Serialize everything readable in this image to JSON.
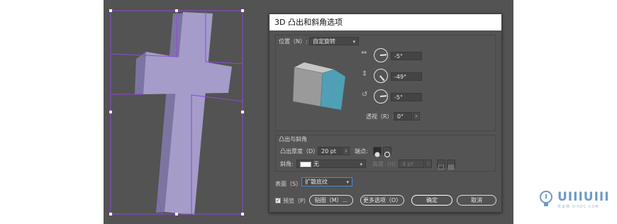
{
  "dialog": {
    "title": "3D 凸出和斜角选项"
  },
  "position": {
    "label": "位置（N）:",
    "preset": "自定旋转",
    "x_angle": "-5°",
    "y_angle": "-49°",
    "z_angle": "-5°",
    "perspective_label": "透视（R）:",
    "perspective_value": "0°"
  },
  "extrude": {
    "section_label": "凸出与斜角",
    "depth_label": "凸出厚度（D）:",
    "depth_value": "20 pt",
    "cap_label": "端点:",
    "bevel_label": "斜角:",
    "bevel_value": "无",
    "height_label": "高度（H）:",
    "height_value": "4 pt"
  },
  "surface": {
    "label": "表面（S）:",
    "value": "扩散底纹"
  },
  "footer": {
    "preview_label": "预览（P）",
    "map_button": "贴图（M）...",
    "more_options_button": "更多选项（O）",
    "ok_button": "确定",
    "cancel_button": "取消"
  },
  "watermark": {
    "brand": "UIIIUIII",
    "sub": "优设网 UISDC.COM"
  },
  "colors": {
    "canvas": "#535353",
    "cross_front": "#a59cc9",
    "cross_side": "#7d75a1",
    "selection": "#8b4ad6",
    "cube_left": "#9a9a9a",
    "cube_right": "#4fa0b5",
    "cube_top": "#c6c6c6"
  }
}
